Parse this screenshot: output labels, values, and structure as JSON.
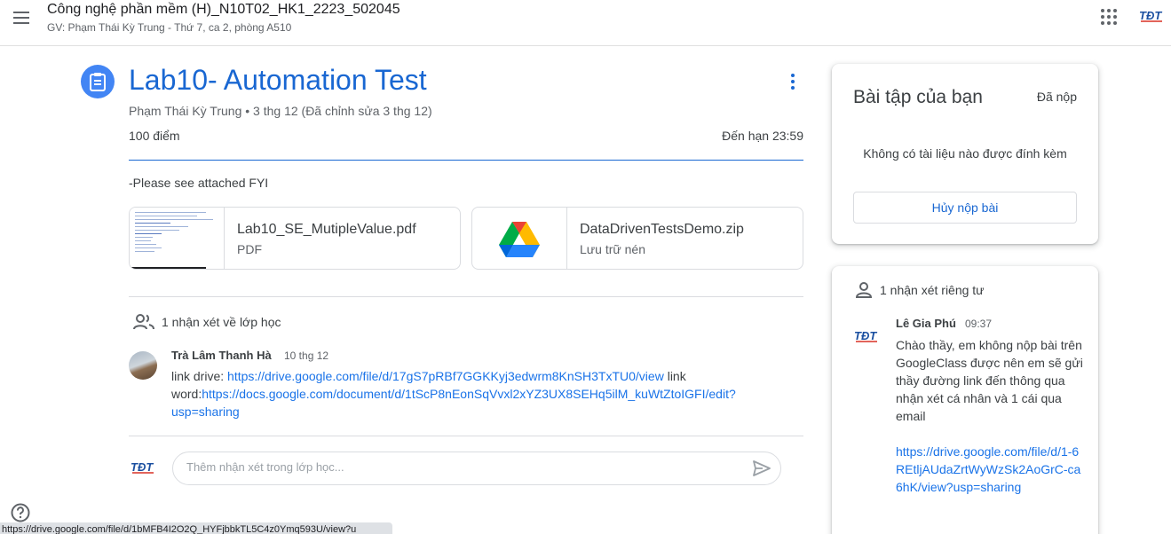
{
  "header": {
    "course_title": "Công nghệ phần mềm (H)_N10T02_HK1_2223_502045",
    "course_subtitle": "GV: Phạm Thái Kỳ Trung - Thứ 7, ca 2, phòng A510",
    "menu_icon": "hamburger-menu-icon",
    "apps_icon": "google-apps-grid-icon",
    "logo": "tdt-logo"
  },
  "assignment": {
    "icon": "assignment-clipboard-icon",
    "title": "Lab10- Automation Test",
    "meta": "Phạm Thái Kỳ Trung • 3 thg 12 (Đã chỉnh sửa 3 thg 12)",
    "points": "100 điểm",
    "due": "Đến hạn 23:59",
    "description": "-Please see attached FYI",
    "attachments": [
      {
        "name": "Lab10_SE_MutipleValue.pdf",
        "type": "PDF",
        "thumb": "pdf-preview"
      },
      {
        "name": "DataDrivenTestsDemo.zip",
        "type": "Lưu trữ nén",
        "thumb": "google-drive-icon"
      }
    ]
  },
  "class_comments": {
    "label": "1 nhận xét về lớp học",
    "items": [
      {
        "author": "Trà Lâm Thanh Hà",
        "date": "10 thg 12",
        "prefix1": "link drive: ",
        "link1": "https://drive.google.com/file/d/17gS7pRBf7GGKKyj3edwrm8KnSH3TxTU0/view",
        "middle": " link word:",
        "link2": "https://docs.google.com/document/d/1tScP8nEonSqVvxl2xYZ3UX8SEHq5ilM_kuWtZtoIGFI/edit?usp=sharing"
      }
    ],
    "input_placeholder": "Thêm nhận xét trong lớp học..."
  },
  "your_work": {
    "title": "Bài tập của bạn",
    "status": "Đã nộp",
    "empty_text": "Không có tài liệu nào được đính kèm",
    "unsubmit_label": "Hủy nộp bài"
  },
  "private_comments": {
    "label": "1 nhận xét riêng tư",
    "author": "Lê Gia Phú",
    "time": "09:37",
    "body": "Chào thầy, em không nộp bài trên GoogleClass được nên em sẽ gửi thầy đường link đến thông qua nhận xét cá nhân và 1 cái qua email",
    "link": "https://drive.google.com/file/d/1-6REtljAUdaZrtWyWzSk2AoGrC-ca6hK/view?usp=sharing"
  },
  "status_bar_url": "https://drive.google.com/file/d/1bMFB4I2O2Q_HYFjbbkTL5C4z0Ymq593U/view?u",
  "colors": {
    "accent": "#1967d2",
    "link": "#1a73e8",
    "icon_blue": "#4285f4"
  }
}
